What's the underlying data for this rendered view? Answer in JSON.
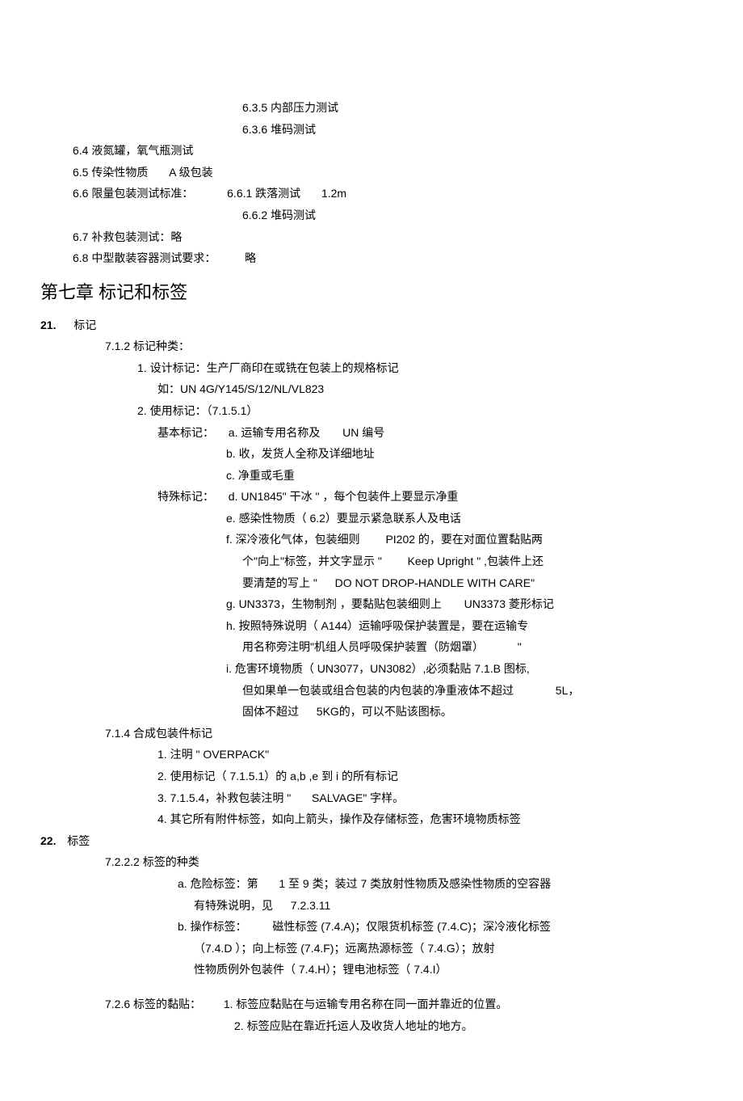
{
  "lines": {
    "l1": "6.3.5  内部压力测试",
    "l2": "6.3.6  堆码测试",
    "l3": "6.4  液氮罐，氧气瓶测试",
    "l4a": "6.5  传染性物质",
    "l4b": "A 级包装",
    "l5a": "6.6  限量包装测试标准：",
    "l5b": "6.6.1  跌落测试",
    "l5c": "1.2m",
    "l6": "6.6.2  堆码测试",
    "l7": "6.7  补救包装测试：略",
    "l8a": "6.8  中型散装容器测试要求：",
    "l8b": "略",
    "chapter": "第七章   标记和标签",
    "s21a": "21.",
    "s21b": "标记",
    "l9": "7.1.2  标记种类：",
    "l10": "1.  设计标记：生产厂商印在或铣在包装上的规格标记",
    "l11": "如：UN 4G/Y145/S/12/NL/VL823",
    "l12": "2.  使用标记：（7.1.5.1）",
    "l13a": "基本标记：",
    "l13b": "a.  运输专用名称及",
    "l13c": "UN 编号",
    "l14": "b.  收，发货人全称及详细地址",
    "l15": "c.  净重或毛重",
    "l16a": "特殊标记：",
    "l16b": "d. UN1845\" 干冰 \" ，每个包装件上要显示净重",
    "l17": "e.  感染性物质（  6.2）要显示紧急联系人及电话",
    "l18a": "f.  深冷液化气体，包装细则",
    "l18b": "PI202  的，要在对面位置黏贴两",
    "l19a": "个\"向上\"标签，并文字显示 \"",
    "l19b": "Keep Upright \" ,包装件上还",
    "l20a": "要清楚的写上 \"",
    "l20b": "DO NOT DROP-HANDLE WITH CARE\"",
    "l21a": "g. UN3373，生物制剂  ，要黏贴包装细则上",
    "l21b": "UN3373  菱形标记",
    "l22a": "h.  按照特殊说明（  A144）运输呼吸保护装置是，要在运输专",
    "l23a": "用名称旁注明\"机组人员呼吸保护装置（防烟罩）",
    "l23b": "\"",
    "l24a": "i.  危害环境物质（  UN3077，UN3082）,必须黏贴  7.1.B  图标,",
    "l25a": "但如果单一包装或组合包装的内包装的净重液体不超过",
    "l25b": "5L，",
    "l26a": "固体不超过",
    "l26b": "5KG的，可以不贴该图标。",
    "l27": "7.1.4  合成包装件标记",
    "l28": "1.  注明 \" OVERPACK\"",
    "l29": "2.  使用标记（  7.1.5.1）的  a,b ,e  到  i  的所有标记",
    "l30a": "3. 7.1.5.4，补救包装注明 \"",
    "l30b": "SALVAGE\"  字样。",
    "l31": "4.  其它所有附件标签，如向上箭头，操作及存储标签，危害环境物质标签",
    "s22a": "22.",
    "s22b": "标签",
    "l32": "7.2.2.2   标签的种类",
    "l33a": "a.  危险标签：第",
    "l33b": "1 至  9 类；装过  7 类放射性物质及感染性物质的空容器",
    "l34a": "有特殊说明，见",
    "l34b": "7.2.3.11",
    "l35a": "b.  操作标签：",
    "l35b": "磁性标签  (7.4.A)；仅限货机标签   (7.4.C)；深冷液化标签",
    "l36a": "（7.4.D ）；向上标签  (7.4.F)；远离热源标签（   7.4.G）；放射",
    "l37a": "性物质例外包装件（   7.4.H）；锂电池标签（   7.4.I）",
    "l38a": "7.2.6   标签的黏贴：",
    "l38b": "1.  标签应黏贴在与运输专用名称在同一面并靠近的位置。",
    "l39": "2.  标签应贴在靠近托运人及收货人地址的地方。"
  }
}
